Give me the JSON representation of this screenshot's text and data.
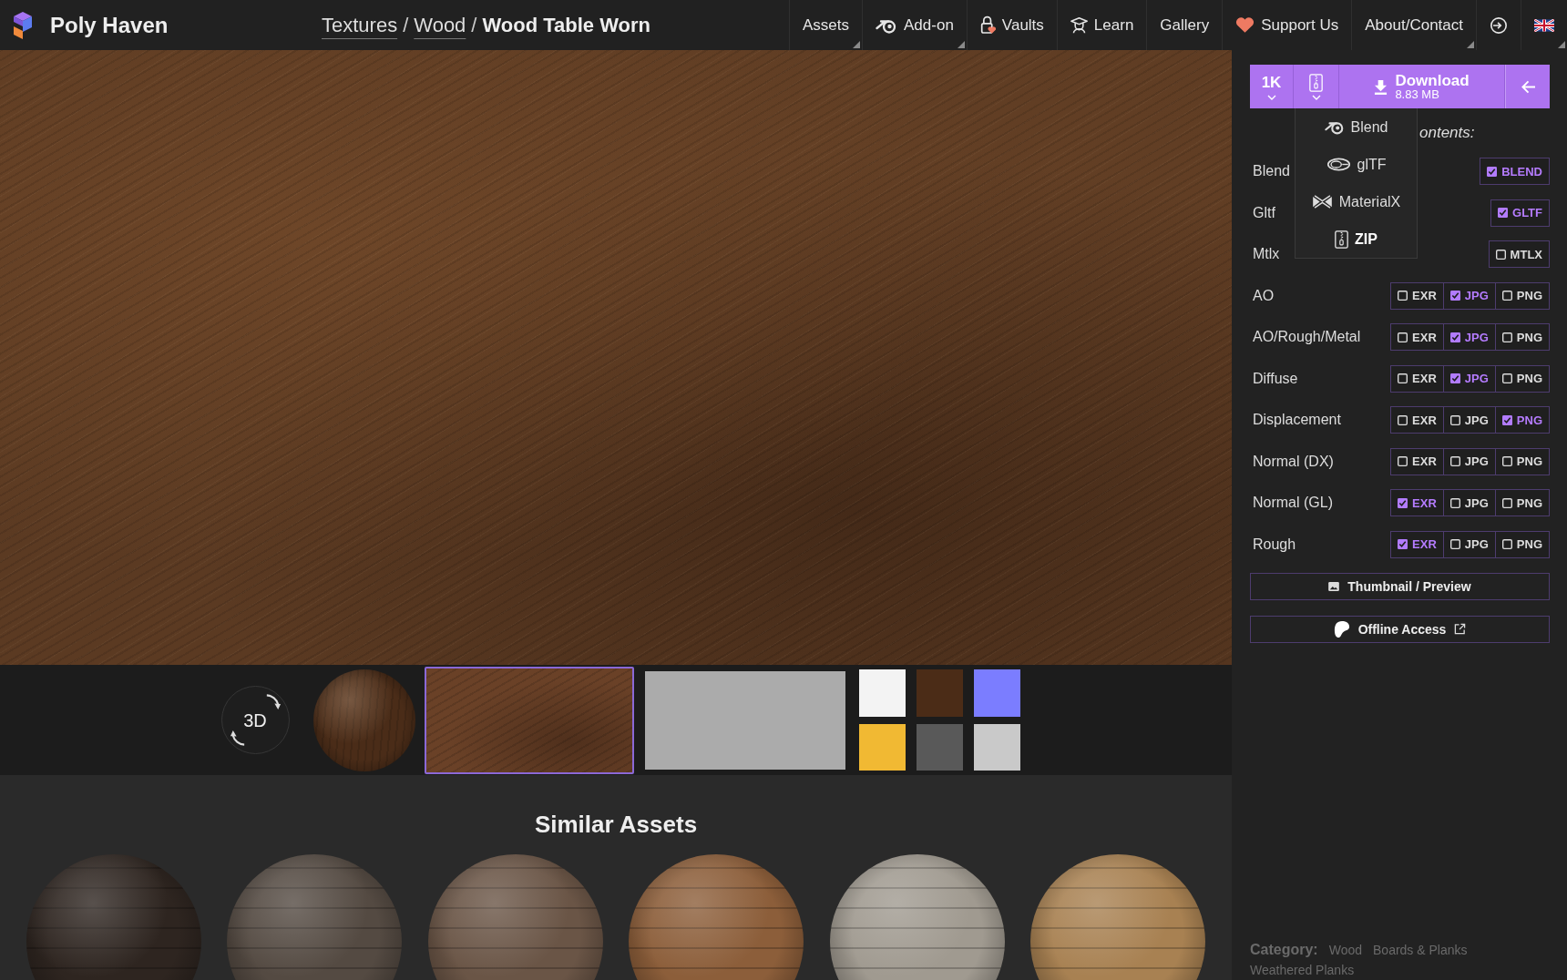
{
  "header": {
    "logo": "Poly Haven",
    "breadcrumb": {
      "separator": "/",
      "items": [
        {
          "label": "Textures",
          "link": true
        },
        {
          "label": "Wood",
          "link": true
        },
        {
          "label": "Wood Table Worn",
          "link": false
        }
      ]
    },
    "nav": [
      {
        "kind": "text",
        "label": "Assets",
        "dropdown": true
      },
      {
        "kind": "blender",
        "label": "Add-on",
        "dropdown": true
      },
      {
        "kind": "vault",
        "label": "Vaults",
        "dropdown": false
      },
      {
        "kind": "learn",
        "label": "Learn",
        "dropdown": false
      },
      {
        "kind": "text",
        "label": "Gallery",
        "dropdown": false
      },
      {
        "kind": "heart",
        "label": "Support Us",
        "dropdown": false
      },
      {
        "kind": "text",
        "label": "About/Contact",
        "dropdown": true
      },
      {
        "kind": "login",
        "dropdown": false
      },
      {
        "kind": "flag",
        "dropdown": true
      }
    ]
  },
  "viewer": {
    "thumbnails": [
      {
        "kind": "orbit",
        "label": "3D",
        "selected": false
      },
      {
        "kind": "sphere",
        "selected": false
      },
      {
        "kind": "flat",
        "selected": true
      },
      {
        "kind": "plain",
        "selected": false
      }
    ],
    "maps": [
      {
        "color": "#f3f3f3",
        "selected": false
      },
      {
        "color": "#4b2c17",
        "selected": false
      },
      {
        "color": "#7b7dff",
        "selected": false
      },
      {
        "color": "#f1b933",
        "selected": false
      },
      {
        "color": "#595959",
        "selected": false
      },
      {
        "color": "#c9c9c9",
        "selected": false
      }
    ]
  },
  "similar": {
    "title": "Similar Assets",
    "items": [
      {
        "color": "#2e2520"
      },
      {
        "color": "#544a42"
      },
      {
        "color": "#6a5546"
      },
      {
        "color": "#8c5e3a"
      },
      {
        "color": "#a09a90"
      },
      {
        "color": "#a88152"
      }
    ]
  },
  "download": {
    "resolution": "1K",
    "label": "Download",
    "size": "8.83 MB",
    "menu": {
      "open": true,
      "items": [
        {
          "kind": "blend",
          "label": "Blend",
          "selected": false
        },
        {
          "kind": "gltf",
          "label": "glTF",
          "selected": false
        },
        {
          "kind": "mtlx",
          "label": "MaterialX",
          "selected": false
        },
        {
          "kind": "zip",
          "label": "ZIP",
          "selected": true
        }
      ]
    }
  },
  "contents_heading": "ontents:",
  "files": [
    {
      "label": "Blend",
      "options": [
        {
          "label": "BLEND",
          "checked": true
        }
      ]
    },
    {
      "label": "Gltf",
      "options": [
        {
          "label": "GLTF",
          "checked": true
        }
      ]
    },
    {
      "label": "Mtlx",
      "options": [
        {
          "label": "MTLX",
          "checked": false
        }
      ]
    },
    {
      "label": "AO",
      "options": [
        {
          "label": "EXR",
          "checked": false
        },
        {
          "label": "JPG",
          "checked": true
        },
        {
          "label": "PNG",
          "checked": false
        }
      ]
    },
    {
      "label": "AO/Rough/Metal",
      "options": [
        {
          "label": "EXR",
          "checked": false
        },
        {
          "label": "JPG",
          "checked": true
        },
        {
          "label": "PNG",
          "checked": false
        }
      ]
    },
    {
      "label": "Diffuse",
      "options": [
        {
          "label": "EXR",
          "checked": false
        },
        {
          "label": "JPG",
          "checked": true
        },
        {
          "label": "PNG",
          "checked": false
        }
      ]
    },
    {
      "label": "Displacement",
      "options": [
        {
          "label": "EXR",
          "checked": false
        },
        {
          "label": "JPG",
          "checked": false
        },
        {
          "label": "PNG",
          "checked": true
        }
      ]
    },
    {
      "label": "Normal (DX)",
      "options": [
        {
          "label": "EXR",
          "checked": false
        },
        {
          "label": "JPG",
          "checked": false
        },
        {
          "label": "PNG",
          "checked": false
        }
      ]
    },
    {
      "label": "Normal (GL)",
      "options": [
        {
          "label": "EXR",
          "checked": true
        },
        {
          "label": "JPG",
          "checked": false
        },
        {
          "label": "PNG",
          "checked": false
        }
      ]
    },
    {
      "label": "Rough",
      "options": [
        {
          "label": "EXR",
          "checked": true
        },
        {
          "label": "JPG",
          "checked": false
        },
        {
          "label": "PNG",
          "checked": false
        }
      ]
    }
  ],
  "actions": [
    {
      "kind": "thumbnail",
      "label": "Thumbnail / Preview"
    },
    {
      "kind": "offline",
      "label": "Offline Access"
    }
  ],
  "category": {
    "label": "Category:",
    "links": [
      "Wood",
      "Boards & Planks",
      "Weathered Planks"
    ]
  }
}
